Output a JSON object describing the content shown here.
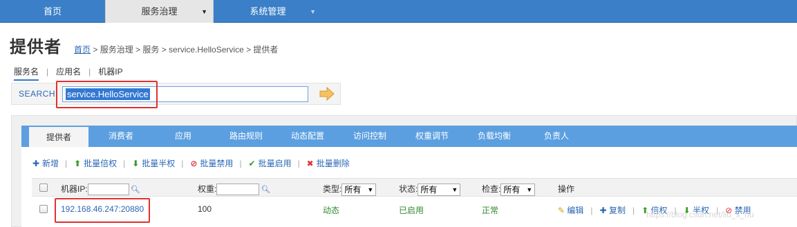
{
  "nav": {
    "items": [
      "首页",
      "服务治理",
      "系统管理"
    ],
    "caret": "▼"
  },
  "header": {
    "title": "提供者",
    "breadcrumb_home": "首页",
    "breadcrumb_rest": " > 服务治理 > 服务 > service.HelloService > 提供者"
  },
  "search": {
    "tabs": [
      "服务名",
      "应用名",
      "机器IP"
    ],
    "label": "SEARCH",
    "value": "service.HelloService"
  },
  "panel_tabs": [
    "提供者",
    "消费者",
    "应用",
    "路由规则",
    "动态配置",
    "访问控制",
    "权重调节",
    "负载均衡",
    "负责人"
  ],
  "actions": [
    "新增",
    "批量倍权",
    "批量半权",
    "批量禁用",
    "批量启用",
    "批量删除"
  ],
  "table": {
    "headers": {
      "ip": "机器IP:",
      "weight": "权重:",
      "type": "类型:",
      "type_value": "所有",
      "status": "状态:",
      "status_value": "所有",
      "check": "检查:",
      "check_value": "所有",
      "ops": "操作"
    },
    "rows": [
      {
        "ip": "192.168.46.247:20880",
        "weight": "100",
        "type": "动态",
        "status": "已启用",
        "check": "正常",
        "ops": [
          "编辑",
          "复制",
          "倍权",
          "半权",
          "禁用"
        ]
      }
    ]
  },
  "watermark": "https://blog.csdn.net/liu_s_hu",
  "colors": {
    "nav": "#3a7fc8",
    "accent": "#5b9fe0",
    "highlight": "#e0312f"
  }
}
